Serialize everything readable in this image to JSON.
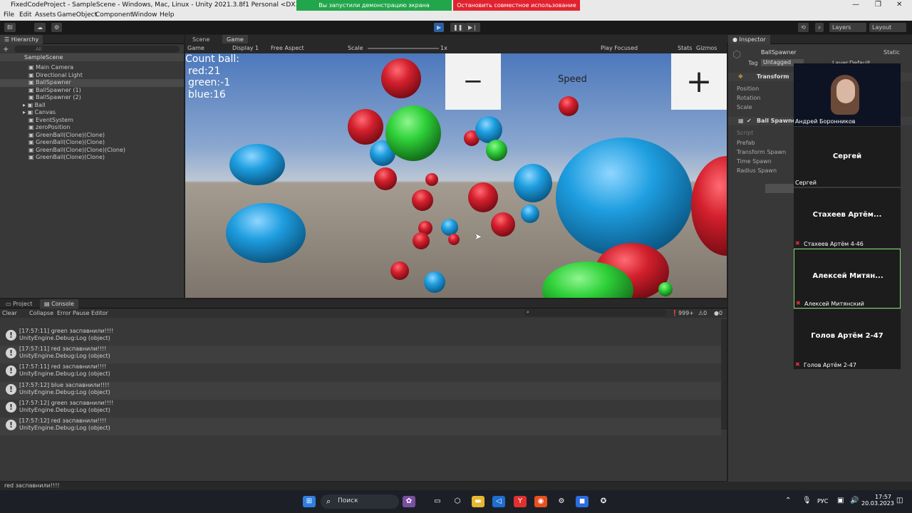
{
  "window": {
    "title": "FixedCodeProject - SampleScene - Windows, Mac, Linux - Unity 2021.3.8f1 Personal <DX11>",
    "minimize": "—",
    "maximize": "❐",
    "close": "✕"
  },
  "share": {
    "notice": "Вы запустили демонстрацию экрана",
    "stop": "Остановить совместное использование"
  },
  "menu": [
    "File",
    "Edit",
    "Assets",
    "GameObject",
    "Component",
    "Window",
    "Help"
  ],
  "toolbar": {
    "account": "BI",
    "layers": "Layers",
    "layout": "Layout"
  },
  "hierarchy": {
    "tab": "Hierarchy",
    "search_placeholder": "All",
    "scene": "SampleScene",
    "items": [
      "Main Camera",
      "Directional Light",
      "BallSpawner",
      "BallSpawner (1)",
      "BallSpawner (2)",
      "Ball",
      "Canvas",
      "EventSystem",
      "zeroPosition",
      "GreenBall(Clone)(Clone)",
      "GreenBall(Clone)(Clone)",
      "GreenBall(Clone)(Clone)(Clone)",
      "GreenBall(Clone)(Clone)"
    ]
  },
  "view_tabs": {
    "scene": "Scene",
    "game": "Game"
  },
  "game_bar": {
    "mode": "Game",
    "display": "Display 1",
    "aspect": "Free Aspect",
    "scale_label": "Scale",
    "scale_value": "1x",
    "play_focused": "Play Focused",
    "stats": "Stats",
    "gizmos": "Gizmos"
  },
  "hud": {
    "count_label": "Count ball:",
    "red": "red:21",
    "green": "green:-1",
    "blue": "blue:16",
    "minus": "−",
    "speed": "Speed",
    "plus": "+"
  },
  "console": {
    "tab_project": "Project",
    "tab_console": "Console",
    "clear": "Clear",
    "collapse": "Collapse",
    "error_pause": "Error Pause",
    "editor": "Editor",
    "count_info": "999+",
    "count_warn": "0",
    "count_err": "0",
    "entries": [
      {
        "time": "[17:57:11] green заспавнили!!!!",
        "source": "UnityEngine.Debug:Log (object)"
      },
      {
        "time": "[17:57:11] red заспавнили!!!!",
        "source": "UnityEngine.Debug:Log (object)"
      },
      {
        "time": "[17:57:11] red заспавнили!!!!",
        "source": "UnityEngine.Debug:Log (object)"
      },
      {
        "time": "[17:57:12] blue заспавнили!!!!",
        "source": "UnityEngine.Debug:Log (object)"
      },
      {
        "time": "[17:57:12] green заспавнили!!!!",
        "source": "UnityEngine.Debug:Log (object)"
      },
      {
        "time": "[17:57:12] red заспавнили!!!!",
        "source": "UnityEngine.Debug:Log (object)"
      }
    ],
    "status_line": "red заспавнили!!!!"
  },
  "inspector": {
    "tab": "Inspector",
    "object_name": "BallSpawner",
    "static": "Static",
    "tag_label": "Tag",
    "tag_value": "Untagged",
    "layer_label": "Layer",
    "layer_value": "Default",
    "transform": "Transform",
    "position": "Position",
    "rotation": "Rotation",
    "scale": "Scale",
    "component": "Ball Spawner",
    "script": "Script",
    "prefab": "Prefab",
    "transform_spawn": "Transform Spawn",
    "time_spawn": "Time Spawn",
    "radius_spawn": "Radius Spawn"
  },
  "participants": {
    "host": "Андрей Боронников",
    "list": [
      {
        "big": "Сергей",
        "small": "Сергей"
      },
      {
        "big": "Стахеев Артём...",
        "small": "Стахеев Артём 4-46"
      },
      {
        "big": "Алексей Митян...",
        "small": "Алексей Митянский"
      },
      {
        "big": "Голов Артём 2-47",
        "small": "Голов Артём 2-47"
      }
    ]
  },
  "taskbar": {
    "search": "Поиск",
    "lang": "РУС",
    "time": "17:57",
    "date": "20.03.2023"
  },
  "colors": {
    "red_ball": "#d3202d",
    "green_ball": "#2fd13a",
    "blue_ball": "#1e9ee0"
  }
}
